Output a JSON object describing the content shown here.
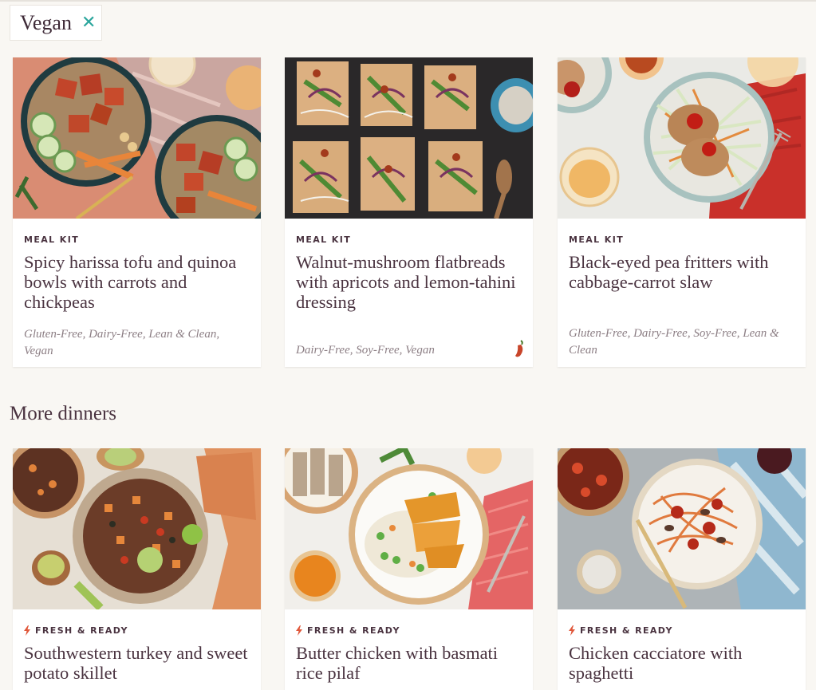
{
  "filter": {
    "label": "Vegan",
    "close_symbol": "✕"
  },
  "vegan_cards": [
    {
      "category": "MEAL KIT",
      "title": "Spicy harissa tofu and quinoa bowls with carrots and chickpeas",
      "tags": "Gluten-Free, Dairy-Free, Lean & Clean, Vegan",
      "image_icon": "tofu-bowl-photo"
    },
    {
      "category": "MEAL KIT",
      "title": "Walnut-mushroom flatbreads with apricots and lemon-tahini dressing",
      "tags": "Dairy-Free, Soy-Free, Vegan",
      "image_icon": "flatbread-photo",
      "spicy_icon": "chili-pepper-icon"
    },
    {
      "category": "MEAL KIT",
      "title": "Black-eyed pea fritters with cabbage-carrot slaw",
      "tags": "Gluten-Free, Dairy-Free, Soy-Free, Lean & Clean",
      "image_icon": "fritters-photo"
    }
  ],
  "more_dinners": {
    "heading": "More dinners",
    "cards": [
      {
        "category": "FRESH & READY",
        "category_icon": "lightning-icon",
        "title": "Southwestern turkey and sweet potato skillet",
        "image_icon": "turkey-skillet-photo"
      },
      {
        "category": "FRESH & READY",
        "category_icon": "lightning-icon",
        "title": "Butter chicken with basmati rice pilaf",
        "image_icon": "butter-chicken-photo"
      },
      {
        "category": "FRESH & READY",
        "category_icon": "lightning-icon",
        "title": "Chicken cacciatore with spaghetti",
        "image_icon": "cacciatore-photo"
      }
    ]
  },
  "colors": {
    "background": "#f9f7f3",
    "text": "#4a3340",
    "tag_text": "#8c7e84",
    "chip_close": "#2aa59c",
    "lightning": "#e0573a"
  }
}
